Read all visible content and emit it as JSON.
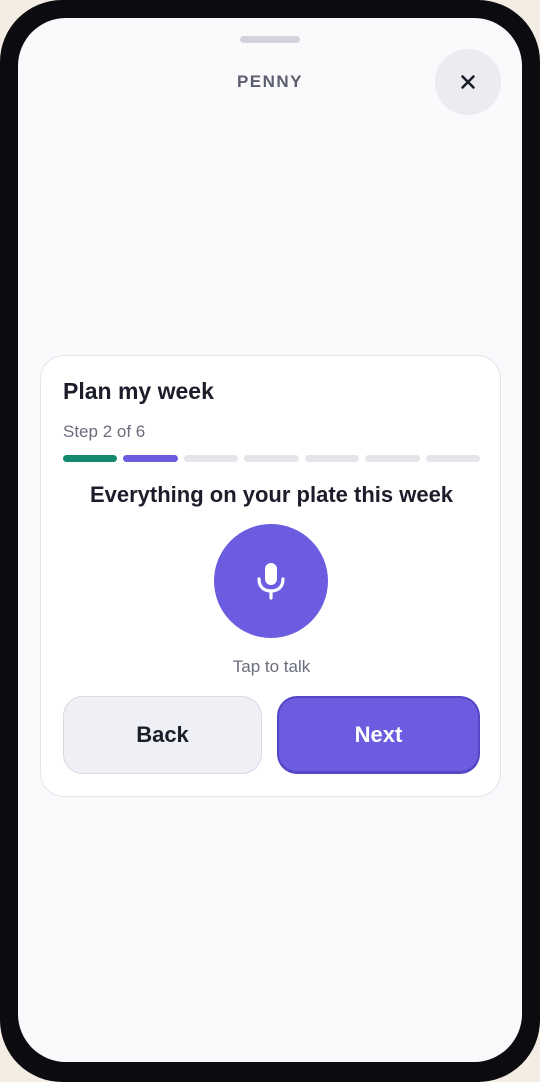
{
  "header": {
    "app_name": "PENNY",
    "close_label": "×"
  },
  "card": {
    "title": "Plan my week",
    "step_label": "Step 2 of 6",
    "progress": {
      "total_segments": 7,
      "completed_segments": 1,
      "current_segment": 2
    },
    "prompt": "Everything on your plate this week",
    "mic_hint": "Tap to talk",
    "back_label": "Back",
    "next_label": "Next"
  },
  "colors": {
    "accent": "#6b5ce0",
    "progress_done": "#138a70",
    "progress_empty": "#e4e5ea",
    "text_primary": "#1c1d2b",
    "text_secondary": "#6a6d7c"
  },
  "icons": {
    "close": "close-icon",
    "mic": "microphone-icon"
  }
}
